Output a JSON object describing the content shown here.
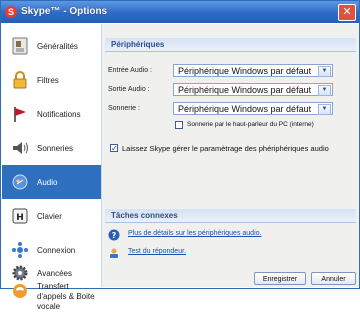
{
  "window": {
    "title": "Skype™ - Options",
    "logo": "S"
  },
  "sidebar": {
    "items": [
      {
        "label": "Généralités",
        "icon": "general-settings-icon"
      },
      {
        "label": "Filtres",
        "icon": "lock-icon"
      },
      {
        "label": "Notifications",
        "icon": "flag-icon"
      },
      {
        "label": "Sonneries",
        "icon": "speaker-icon"
      },
      {
        "label": "Audio",
        "icon": "audio-icon",
        "active": true
      },
      {
        "label": "Clavier",
        "icon": "keyboard-icon"
      },
      {
        "label": "Connexion",
        "icon": "connection-icon"
      },
      {
        "label": "Avancées",
        "icon": "gear-icon"
      },
      {
        "label": "Transfert d'appels & Boite vocale",
        "icon": "call-transfer-icon"
      }
    ]
  },
  "peripherals": {
    "header": "Périphériques",
    "input_label": "Entrée Audio :",
    "input_value": "Périphérique Windows par défaut",
    "output_label": "Sortie Audio :",
    "output_value": "Périphérique Windows par défaut",
    "ring_label": "Sonnerie :",
    "ring_value": "Périphérique Windows par défaut",
    "pc_speaker_label": "Sonnerie par le haut-parleur du PC (interne)",
    "pc_speaker_checked": false,
    "auto_label": "Laissez Skype gérer le paramètrage des phériphériques audio",
    "auto_checked": true
  },
  "tasks": {
    "header": "Tâches connexes",
    "link1": "Plus de détails sur les périphériques audio.",
    "link2": "Test du répondeur."
  },
  "buttons": {
    "save": "Enregistrer",
    "cancel": "Annuler"
  },
  "colors": {
    "titlebar": "#2d6ac6",
    "active_item": "#2e6fc0",
    "link": "#1b4fb3",
    "close": "#e0513d"
  }
}
